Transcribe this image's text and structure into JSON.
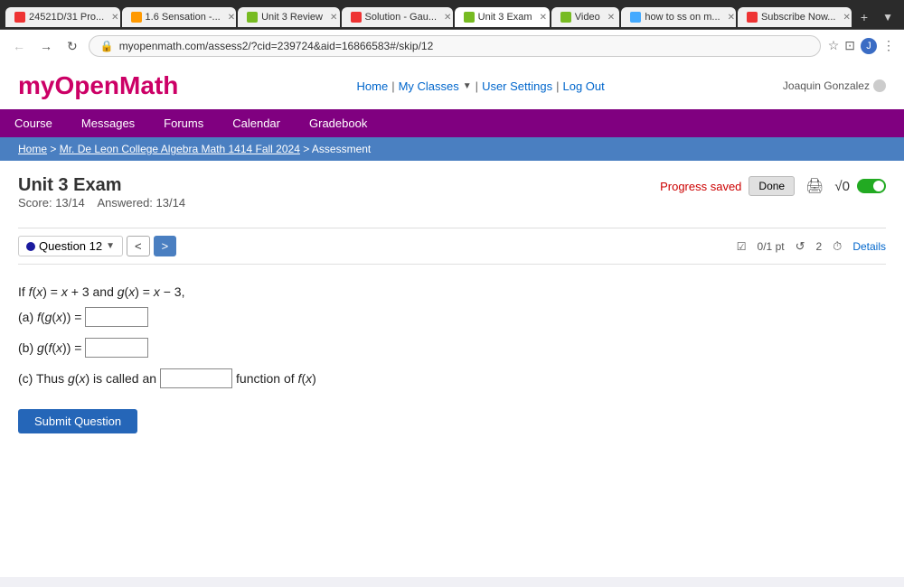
{
  "browser": {
    "tabs": [
      {
        "id": 1,
        "label": "24521D/31 Pro...",
        "color": "#e33",
        "active": false
      },
      {
        "id": 2,
        "label": "1.6 Sensation -...",
        "color": "#f90",
        "active": false
      },
      {
        "id": 3,
        "label": "Unit 3 Review",
        "color": "#7b2",
        "active": false
      },
      {
        "id": 4,
        "label": "Solution - Gau...",
        "color": "#e33",
        "active": false
      },
      {
        "id": 5,
        "label": "Unit 3 Exam",
        "color": "#7b2",
        "active": true
      },
      {
        "id": 6,
        "label": "Video",
        "color": "#7b2",
        "active": false
      },
      {
        "id": 7,
        "label": "how to ss on m...",
        "color": "#4af",
        "active": false
      },
      {
        "id": 8,
        "label": "Subscribe Now...",
        "color": "#e33",
        "active": false
      }
    ],
    "url": "myopenmath.com/assess2/?cid=239724&aid=16866583#/skip/12"
  },
  "site": {
    "logo_my": "my",
    "logo_open": "Open",
    "logo_math": "Math",
    "nav": {
      "home": "Home",
      "my_classes": "My Classes",
      "user_settings": "User Settings",
      "logout": "Log Out"
    },
    "user": "Joaquin Gonzalez"
  },
  "menu": {
    "items": [
      "Course",
      "Messages",
      "Forums",
      "Calendar",
      "Gradebook"
    ]
  },
  "breadcrumb": {
    "home": "Home",
    "course": "Mr. De Leon College Algebra Math 1414 Fall 2024",
    "section": "Assessment",
    "separator": ">"
  },
  "question": {
    "title": "Unit 3 Exam",
    "score_label": "Score:",
    "score_value": "13/14",
    "answered_label": "Answered:",
    "answered_value": "13/14",
    "progress_saved": "Progress saved",
    "done_btn": "Done",
    "question_number": "Question 12",
    "pts": "0/1 pt",
    "retries": "2",
    "details": "Details",
    "problem_text": "If f(x) = x + 3 and g(x) = x − 3,",
    "part_a_label": "(a) f(g(x)) =",
    "part_b_label": "(b) g(f(x)) =",
    "part_c_prefix": "(c) Thus g(x) is called an",
    "part_c_suffix": "function of f(x)",
    "submit_btn": "Submit Question"
  }
}
